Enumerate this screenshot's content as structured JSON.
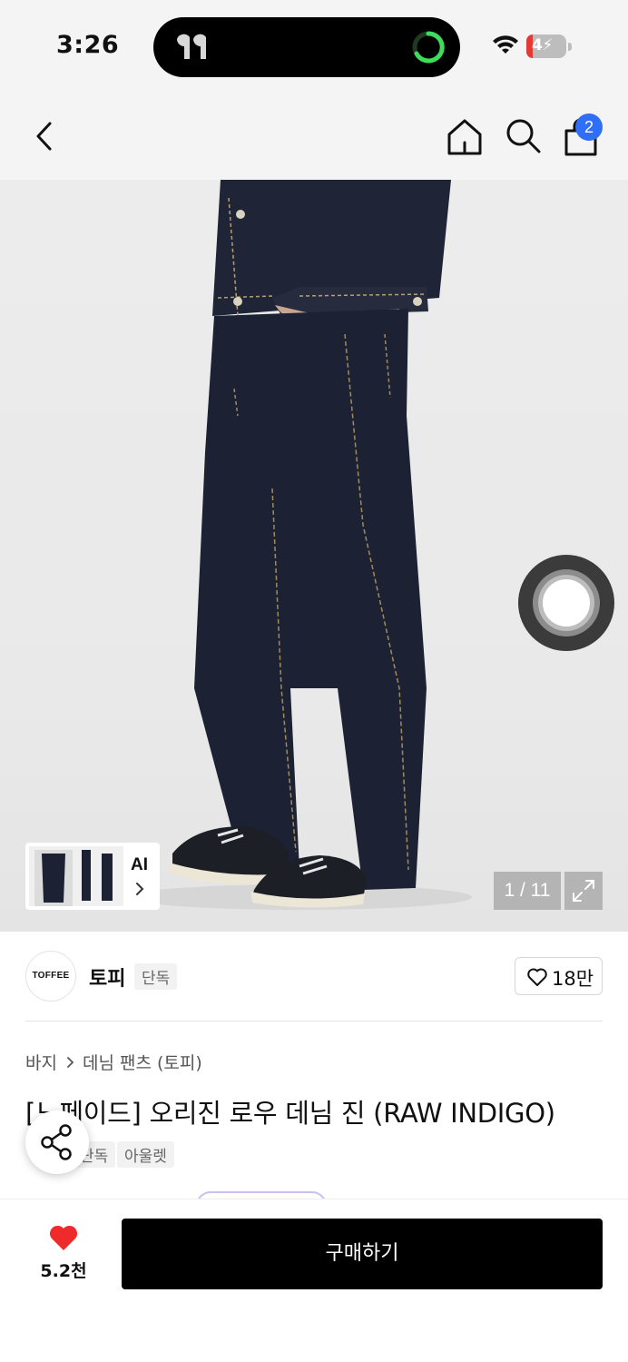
{
  "status_bar": {
    "time": "3:26",
    "battery_level": "4",
    "icons": [
      "airpods-icon",
      "activity-ring-icon",
      "wifi-icon",
      "battery-charging-icon"
    ]
  },
  "header": {
    "icons": [
      "chevron-left-icon",
      "home-icon",
      "search-icon",
      "shopping-bag-icon"
    ],
    "cart_badge": "2"
  },
  "gallery": {
    "thumbnail_label": "AI",
    "page_counter": "1 / 11",
    "image_subject": "raw indigo wide-leg denim jeans with denim jacket and white sneakers"
  },
  "brand": {
    "logo_text": "TOFFEE",
    "name": "토피",
    "tag": "단독",
    "like_count": "18만"
  },
  "product": {
    "breadcrumb": [
      "바지",
      "데님 팬츠 (토피)"
    ],
    "title": "[노페이드] 오리진 로우 데님 진 (RAW INDIGO)",
    "tags": [
      "단독",
      "아울렛"
    ]
  },
  "bottom_bar": {
    "favorite_count": "5.2천",
    "buy_label": "구매하기"
  },
  "colors": {
    "accent_heart": "#ee2a2a",
    "badge_blue": "#2f6ef6",
    "buy_button": "#000000"
  }
}
